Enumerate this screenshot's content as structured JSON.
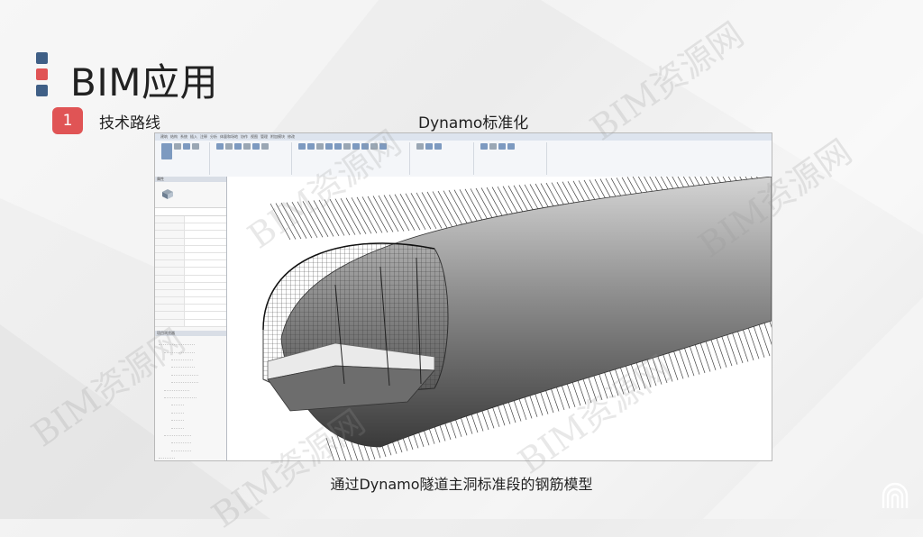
{
  "page": {
    "title": "BIM应用",
    "section_number": "1",
    "section_label": "技术路线",
    "subtitle": "Dynamo标准化",
    "caption": "通过Dynamo隧道主洞标准段的钢筋模型"
  },
  "title_mark_colors": [
    "#3f5f86",
    "#e05455",
    "#3f5f86"
  ],
  "accent": "#e05455",
  "watermark": "BIM资源网",
  "logo_icon": "arch-tunnel-icon",
  "revit": {
    "tabs": [
      "建筑",
      "结构",
      "系统",
      "插入",
      "注释",
      "分析",
      "体量和场地",
      "协作",
      "视图",
      "管理",
      "附加模块",
      "修改"
    ],
    "properties_header": "属性",
    "browser_header": "项目浏览器"
  }
}
